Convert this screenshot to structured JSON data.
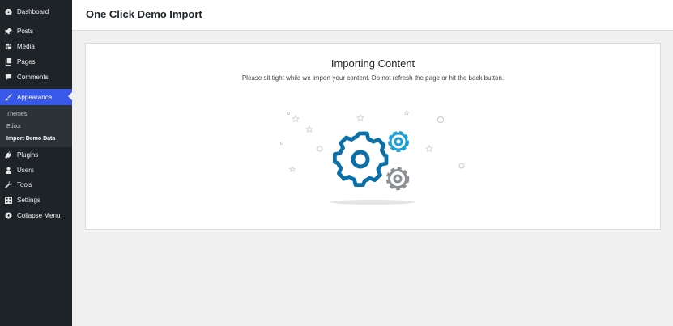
{
  "sidebar": {
    "items": [
      {
        "label": "Dashboard",
        "icon": "dashboard-icon"
      },
      {
        "label": "Posts",
        "icon": "pin-icon"
      },
      {
        "label": "Media",
        "icon": "media-icon"
      },
      {
        "label": "Pages",
        "icon": "pages-icon"
      },
      {
        "label": "Comments",
        "icon": "comment-icon"
      },
      {
        "label": "Appearance",
        "icon": "brush-icon",
        "active": true
      },
      {
        "label": "Plugins",
        "icon": "plug-icon"
      },
      {
        "label": "Users",
        "icon": "user-icon"
      },
      {
        "label": "Tools",
        "icon": "wrench-icon"
      },
      {
        "label": "Settings",
        "icon": "settings-icon"
      },
      {
        "label": "Collapse Menu",
        "icon": "collapse-icon"
      }
    ],
    "submenu": [
      {
        "label": "Themes"
      },
      {
        "label": "Editor"
      },
      {
        "label": "Import Demo Data",
        "current": true
      }
    ]
  },
  "header": {
    "title": "One Click Demo Import"
  },
  "card": {
    "title": "Importing Content",
    "subtitle": "Please sit tight while we import your content. Do not refresh the page or hit the back button."
  },
  "colors": {
    "sidebar": "#1d2327",
    "accent": "#3858e9",
    "gear_blue": "#0c70a8",
    "gear_cyan": "#1ea1d8",
    "gear_gray": "#8c8f94"
  }
}
